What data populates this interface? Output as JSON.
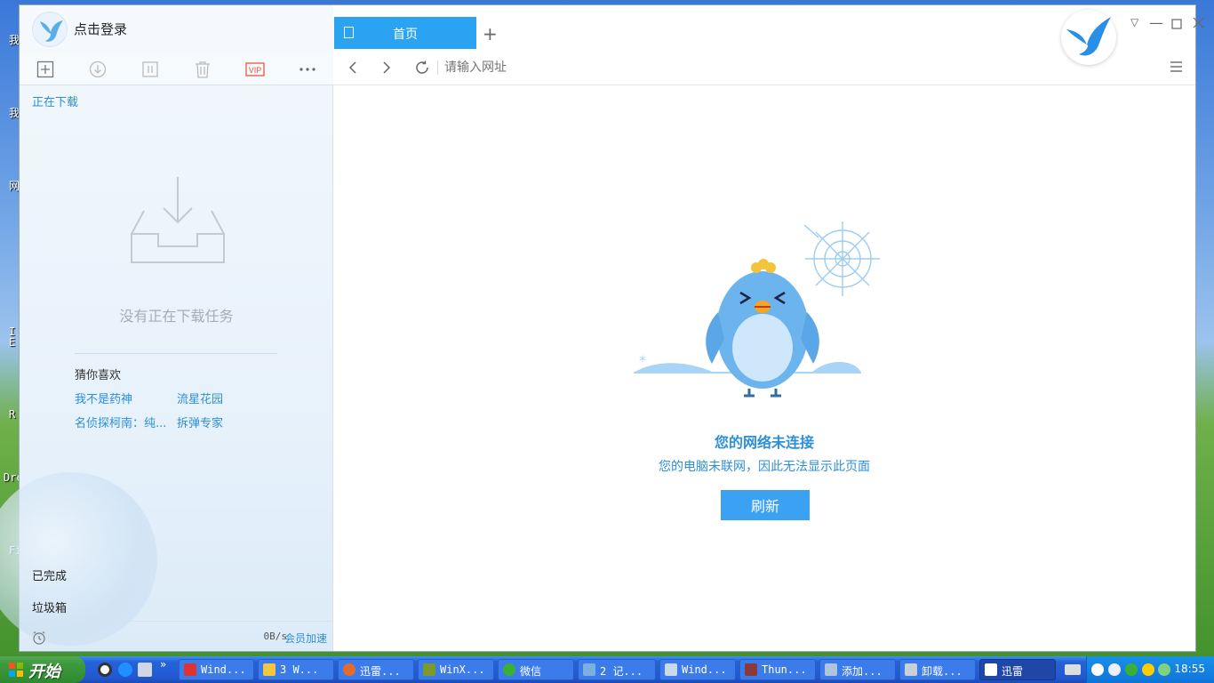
{
  "app": {
    "login_text": "点击登录"
  },
  "sidebar": {
    "section_downloading": "正在下载",
    "empty_text": "没有正在下载任务",
    "guess_title": "猜你喜欢",
    "recommendations": [
      "我不是药神",
      "流星花园",
      "名侦探柯南：纯...",
      "拆弹专家"
    ],
    "completed": "已完成",
    "trash": "垃圾箱",
    "speed": "0B/s",
    "vip_accelerate": "会员加速",
    "toolbar": {
      "new": "plus-icon",
      "start": "download-icon",
      "pause": "pause-icon",
      "delete": "trash-icon",
      "vip_label": "VIP",
      "more": "more-icon"
    }
  },
  "browser": {
    "tab_label": "首页",
    "url_placeholder": "请输入网址",
    "error_title": "您的网络未连接",
    "error_desc": "您的电脑未联网，因此无法显示此页面",
    "refresh_label": "刷新"
  },
  "desktop_fragments": [
    "我",
    "我",
    "网",
    "I",
    "E",
    "R",
    "Dre",
    "Fi"
  ],
  "taskbar": {
    "start_label": "开始",
    "chevron": "»",
    "tasks": [
      {
        "label": "Wind..."
      },
      {
        "label": "3 W..."
      },
      {
        "label": "迅雷..."
      },
      {
        "label": "WinX..."
      },
      {
        "label": "微信"
      },
      {
        "label": "2 记..."
      },
      {
        "label": "Wind..."
      },
      {
        "label": "Thun..."
      },
      {
        "label": "添加..."
      },
      {
        "label": "卸载..."
      },
      {
        "label": "迅雷"
      }
    ],
    "clock": "18:55"
  },
  "colors": {
    "accent": "#2aa3f2",
    "link": "#2d8fd7",
    "vip": "#e8573f",
    "taskbar": "#2258d0",
    "start_green": "#3c9a3c"
  }
}
